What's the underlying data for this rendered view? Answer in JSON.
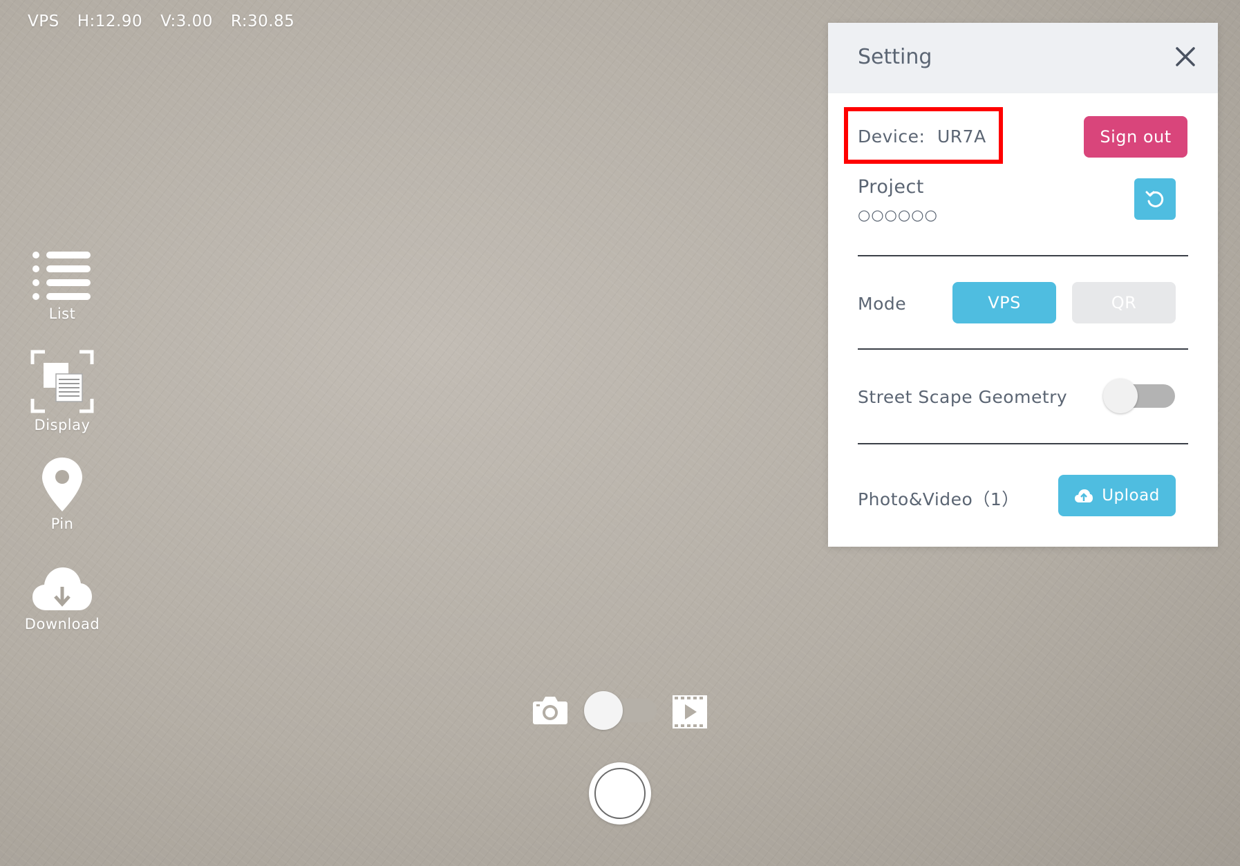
{
  "status_bar": {
    "mode": "VPS",
    "h": "H:12.90",
    "v": "V:3.00",
    "r": "R:30.85"
  },
  "sidebar": {
    "items": [
      {
        "label": "List",
        "icon": "list-icon"
      },
      {
        "label": "Display",
        "icon": "display-icon"
      },
      {
        "label": "Pin",
        "icon": "pin-icon"
      },
      {
        "label": "Download",
        "icon": "cloud-download-icon"
      }
    ]
  },
  "settings": {
    "title": "Setting",
    "device_label": "Device:",
    "device_value": "UR7A",
    "sign_out_label": "Sign out",
    "project_label": "Project",
    "project_value": "○○○○○○",
    "mode_label": "Mode",
    "mode_options": [
      "VPS",
      "QR"
    ],
    "mode_selected": "VPS",
    "geometry_label": "Street Scape Geometry",
    "geometry_enabled": false,
    "photo_video_label": "Photo&Video（1）",
    "upload_label": "Upload",
    "colors": {
      "accent": "#4fbde0",
      "sign_out": "#d9457b",
      "highlight": "#ff0000",
      "text": "#5b6573"
    }
  },
  "capture": {
    "photo_icon": "camera-icon",
    "video_icon": "video-icon",
    "mode": "photo"
  }
}
